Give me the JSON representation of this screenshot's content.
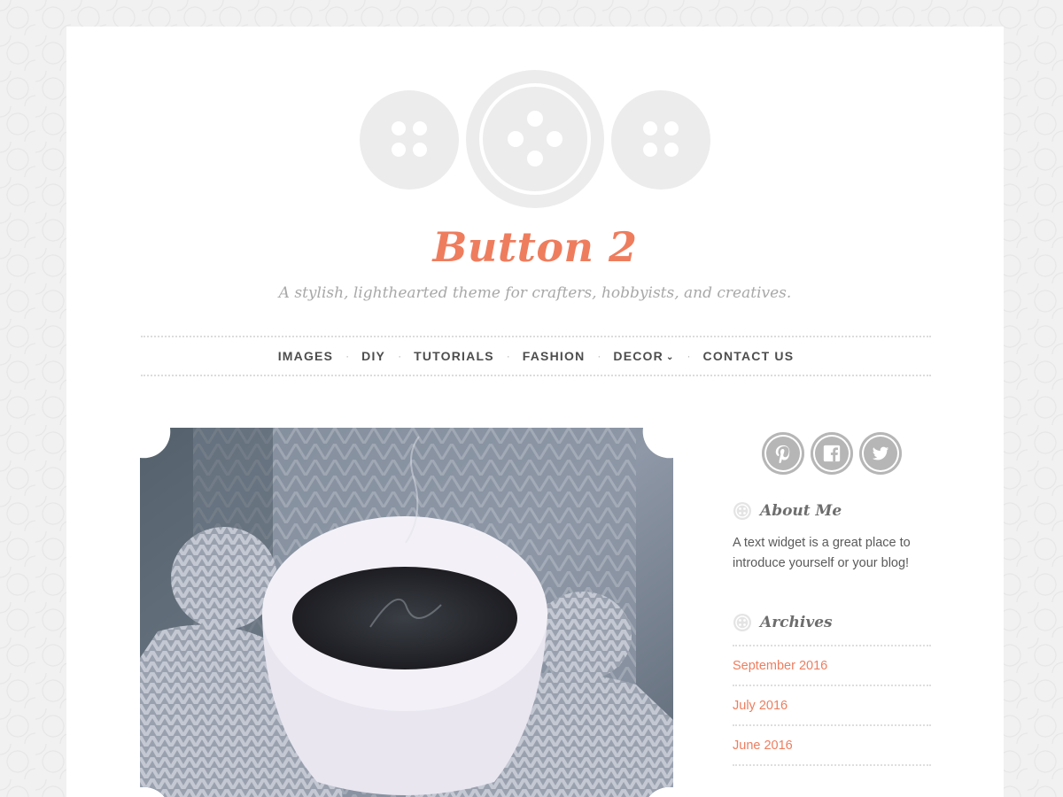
{
  "site": {
    "title": "Button 2",
    "tagline": "A stylish, lighthearted theme for crafters, hobbyists, and creatives."
  },
  "logo": {
    "icon": "three-buttons-logo",
    "color": "#ececec"
  },
  "nav": {
    "items": [
      {
        "label": "IMAGES"
      },
      {
        "label": "DIY"
      },
      {
        "label": "TUTORIALS"
      },
      {
        "label": "FASHION"
      },
      {
        "label": "DECOR",
        "has_dropdown": true
      },
      {
        "label": "CONTACT US"
      }
    ],
    "separator": "·"
  },
  "featured_image": {
    "icon": "coffee-cup-mittens-photo"
  },
  "sidebar": {
    "social": [
      {
        "icon": "pinterest-icon"
      },
      {
        "icon": "facebook-icon"
      },
      {
        "icon": "twitter-icon"
      }
    ],
    "about": {
      "title": "About Me",
      "text": "A text widget is a great place to introduce yourself or your blog!"
    },
    "archives": {
      "title": "Archives",
      "items": [
        "September 2016",
        "July 2016",
        "June 2016"
      ]
    }
  },
  "colors": {
    "accent": "#ee7d5e",
    "nav_text": "#4d4d4d",
    "tagline": "#a8a8a8",
    "social_bg": "#b6b6b6"
  }
}
